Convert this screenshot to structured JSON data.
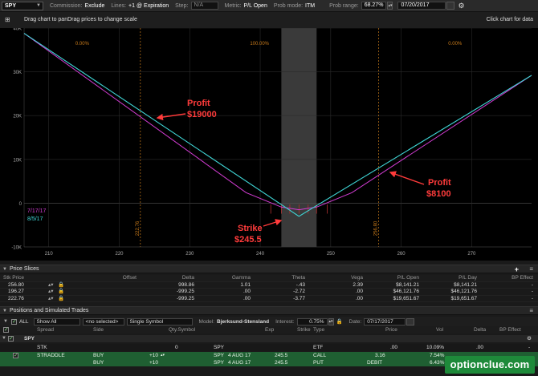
{
  "toolbar": {
    "symbol": "SPY",
    "commission_label": "Commission:",
    "commission_value": "Exclude",
    "lines_label": "Lines:",
    "lines_value": "+1 @ Expiration",
    "step_label": "Step:",
    "step_value": "N/A",
    "metric_label": "Metric:",
    "metric_value": "P/L Open",
    "prob_mode_label": "Prob mode:",
    "prob_mode_value": "ITM",
    "prob_range_label": "Prob range:",
    "prob_range_value": "68.27%",
    "date_value": "07/20/2017"
  },
  "chart_header": {
    "hint": "Drag chart to panDrag prices to change scale",
    "click_hint": "Click chart for data"
  },
  "chart_data": {
    "type": "line",
    "x_ticks": [
      210,
      220,
      230,
      240,
      250,
      260,
      270
    ],
    "y_ticks": [
      {
        "value": 40000,
        "label": "40K"
      },
      {
        "value": 30000,
        "label": "30K"
      },
      {
        "value": 20000,
        "label": "20K"
      },
      {
        "value": 10000,
        "label": "10K"
      },
      {
        "value": 0,
        "label": "0"
      },
      {
        "value": -10000,
        "label": "-10K"
      }
    ],
    "xlim": [
      206.5,
      278.5
    ],
    "ylim": [
      -10000,
      40000
    ],
    "series": [
      {
        "name": "7/17/17",
        "color": "#d23cd2",
        "points": [
          [
            206.5,
            38800
          ],
          [
            238,
            2400
          ],
          [
            243,
            -900
          ],
          [
            245.5,
            -1500
          ],
          [
            248,
            -900
          ],
          [
            253,
            2400
          ],
          [
            278.5,
            29200
          ]
        ]
      },
      {
        "name": "8/5/17",
        "color": "#3fd6d6",
        "points": [
          [
            206.5,
            38800
          ],
          [
            245.5,
            -3000
          ],
          [
            278.5,
            29200
          ]
        ]
      }
    ],
    "prob_zones": [
      {
        "label": "0.00%",
        "boundary": 223
      },
      {
        "label": "100.00%"
      },
      {
        "label": "0.00%",
        "boundary": 256.8
      }
    ],
    "boundary_labels": [
      "222.76",
      "256.80"
    ],
    "strike_band": [
      243,
      248
    ],
    "annotations": {
      "profit_left": {
        "title": "Profit",
        "amount": "$19000"
      },
      "profit_right": {
        "title": "Profit",
        "amount": "$8100"
      },
      "strike": {
        "title": "Strike",
        "amount": "$245.5"
      }
    },
    "colors": {
      "background": "#000000",
      "annotation": "#ff3b3b"
    }
  },
  "price_slices": {
    "title": "Price Slices",
    "headers": {
      "stk_price": "Stk Price",
      "offset": "Offset",
      "delta": "Delta",
      "gamma": "Gamma",
      "theta": "Theta",
      "vega": "Vega",
      "pl_open": "P/L Open",
      "pl_day": "P/L Day",
      "bp_effect": "BP Effect"
    },
    "rows": [
      {
        "stk_price": "256.80",
        "delta": "998.86",
        "gamma": "1.01",
        "theta": "-.43",
        "vega": "2.39",
        "pl_open": "$8,141.21",
        "pl_day": "$8,141.21",
        "bp_effect": "-"
      },
      {
        "stk_price": "196.27",
        "delta": "-999.25",
        "gamma": ".00",
        "theta": "-2.72",
        "vega": ".00",
        "pl_open": "$46,121.76",
        "pl_day": "$46,121.76",
        "bp_effect": "-"
      },
      {
        "stk_price": "222.76",
        "delta": "-999.25",
        "gamma": ".00",
        "theta": "-3.77",
        "vega": ".00",
        "pl_open": "$19,651.67",
        "pl_day": "$19,651.67",
        "bp_effect": "-"
      }
    ]
  },
  "positions": {
    "title": "Positions and Simulated Trades",
    "all_label": "ALL",
    "show_label": "Show All",
    "selected_label": "<no selected>",
    "symbol_mode": "Single Symbol",
    "model_label": "Model:",
    "model_value": "Bjerksund-Stensland",
    "interest_label": "Interest:",
    "interest_value": "0.75%",
    "date_label": "Date:",
    "date_value": "07/17/2017",
    "headers": {
      "spread": "Spread",
      "side": "Side",
      "qty_symbol": "Qty.Symbol",
      "exp": "Exp",
      "strike": "Strike",
      "type": "Type",
      "price": "Price",
      "vol": "Vol",
      "delta": "Delta",
      "bp_effect": "BP Effect"
    },
    "group": "SPY",
    "stock_row": {
      "spread": "STK",
      "qty": "0",
      "symbol": "SPY",
      "type": "ETF",
      "price": ".00",
      "vol": "10.09%",
      "delta": ".00",
      "bp": "-"
    },
    "leg1": {
      "spread": "STRADDLE",
      "side": "BUY",
      "qty": "+10",
      "symbol": "SPY",
      "exp": "4 AUG 17",
      "strike": "245.5",
      "type": "CALL",
      "price": "3.16",
      "vol": "7.54%"
    },
    "leg2": {
      "side": "BUY",
      "qty": "+10",
      "symbol": "SPY",
      "exp": "4 AUG 17",
      "strike": "245.5",
      "type": "PUT",
      "price_type": "DEBIT",
      "vol": "6.43%"
    }
  },
  "watermark": "optionclue.com"
}
